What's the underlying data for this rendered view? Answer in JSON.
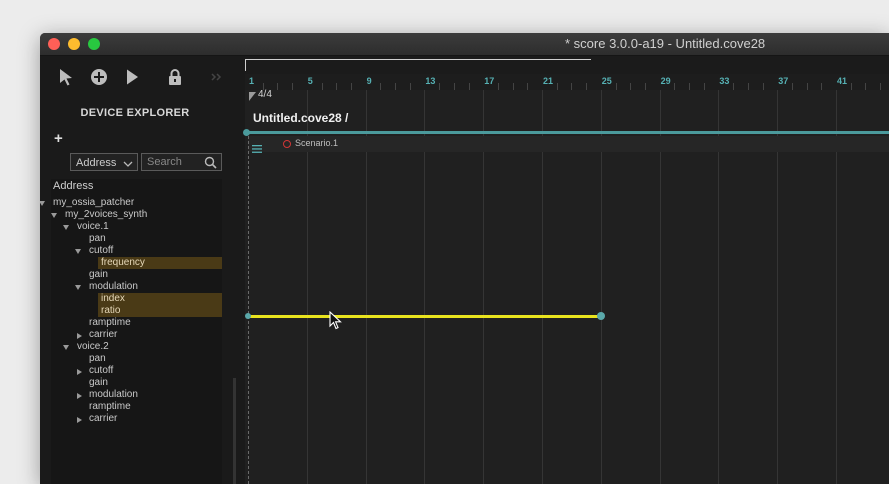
{
  "window": {
    "title": "* score 3.0.0-a19 - Untitled.cove28"
  },
  "toolbar": {
    "tools": [
      "select-arrow-icon",
      "add-plus-icon",
      "play-icon",
      "lock-icon",
      "collapse-chevrons-icon"
    ]
  },
  "explorer": {
    "title": "DEVICE EXPLORER",
    "add_label": "+",
    "address_select": "Address",
    "search_placeholder": "Search",
    "tree_header": "Address",
    "tree": [
      {
        "label": "my_ossia_patcher",
        "depth": 0,
        "arrow": "down",
        "highlighted": false
      },
      {
        "label": "my_2voices_synth",
        "depth": 1,
        "arrow": "down",
        "highlighted": false
      },
      {
        "label": "voice.1",
        "depth": 2,
        "arrow": "down",
        "highlighted": false
      },
      {
        "label": "pan",
        "depth": 3,
        "arrow": "",
        "highlighted": false
      },
      {
        "label": "cutoff",
        "depth": 3,
        "arrow": "down",
        "highlighted": false
      },
      {
        "label": "frequency",
        "depth": 4,
        "arrow": "",
        "highlighted": true
      },
      {
        "label": "gain",
        "depth": 3,
        "arrow": "",
        "highlighted": false
      },
      {
        "label": "modulation",
        "depth": 3,
        "arrow": "down",
        "highlighted": false
      },
      {
        "label": "index",
        "depth": 4,
        "arrow": "",
        "highlighted": true
      },
      {
        "label": "ratio",
        "depth": 4,
        "arrow": "",
        "highlighted": true
      },
      {
        "label": "ramptime",
        "depth": 3,
        "arrow": "",
        "highlighted": false
      },
      {
        "label": "carrier",
        "depth": 3,
        "arrow": "right",
        "highlighted": false
      },
      {
        "label": "voice.2",
        "depth": 2,
        "arrow": "down",
        "highlighted": false
      },
      {
        "label": "pan",
        "depth": 3,
        "arrow": "",
        "highlighted": false
      },
      {
        "label": "cutoff",
        "depth": 3,
        "arrow": "right",
        "highlighted": false
      },
      {
        "label": "gain",
        "depth": 3,
        "arrow": "",
        "highlighted": false
      },
      {
        "label": "modulation",
        "depth": 3,
        "arrow": "right",
        "highlighted": false
      },
      {
        "label": "ramptime",
        "depth": 3,
        "arrow": "",
        "highlighted": false
      },
      {
        "label": "carrier",
        "depth": 3,
        "arrow": "right",
        "highlighted": false
      }
    ]
  },
  "score": {
    "time_signature": "4/4",
    "ruler_labels": [
      "1",
      "5",
      "9",
      "13",
      "17",
      "21",
      "25",
      "29",
      "33",
      "37",
      "41"
    ],
    "process_title": "Untitled.cove28 /",
    "scenario_label": "Scenario.1"
  },
  "colors": {
    "accent_cyan": "#4b9a9c",
    "interval_yellow": "#e8e31e",
    "highlight": "#4a3a16",
    "record_red": "#d23535"
  }
}
